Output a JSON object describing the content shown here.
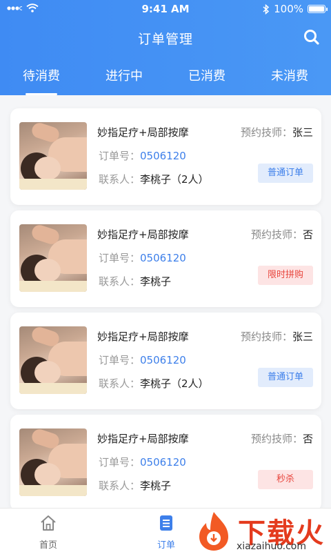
{
  "status_bar": {
    "time": "9:41 AM",
    "battery": "100%"
  },
  "header": {
    "title": "订单管理"
  },
  "tabs": [
    {
      "label": "待消费",
      "active": true
    },
    {
      "label": "进行中",
      "active": false
    },
    {
      "label": "已消费",
      "active": false
    },
    {
      "label": "未消费",
      "active": false
    }
  ],
  "orders": [
    {
      "name": "妙指足疗+局部按摩",
      "tech_label": "预约技师：",
      "tech_value": "张三",
      "order_label": "订单号：",
      "order_no": "0506120",
      "contact_label": "联系人：",
      "contact_value": "李桃子（2人）",
      "badge": "普通订单",
      "badge_color": "#3d7fea",
      "badge_bg": "#e2ecfc"
    },
    {
      "name": "妙指足疗+局部按摩",
      "tech_label": "预约技师：",
      "tech_value": "否",
      "order_label": "订单号：",
      "order_no": "0506120",
      "contact_label": "联系人：",
      "contact_value": "李桃子",
      "badge": "限时拼购",
      "badge_color": "#e8453c",
      "badge_bg": "#fde4e4"
    },
    {
      "name": "妙指足疗+局部按摩",
      "tech_label": "预约技师：",
      "tech_value": "张三",
      "order_label": "订单号：",
      "order_no": "0506120",
      "contact_label": "联系人：",
      "contact_value": "李桃子（2人）",
      "badge": "普通订单",
      "badge_color": "#3d7fea",
      "badge_bg": "#e2ecfc"
    },
    {
      "name": "妙指足疗+局部按摩",
      "tech_label": "预约技师：",
      "tech_value": "否",
      "order_label": "订单号：",
      "order_no": "0506120",
      "contact_label": "联系人：",
      "contact_value": "李桃子",
      "badge": "秒杀",
      "badge_color": "#e8453c",
      "badge_bg": "#fde4e4"
    }
  ],
  "bottom_nav": [
    {
      "label": "首页",
      "icon": "home-icon",
      "active": false,
      "color": "#666666"
    },
    {
      "label": "订单",
      "icon": "order-list-icon",
      "active": true,
      "color": "#3d7fea"
    }
  ],
  "watermark": {
    "text": "下载火",
    "url": "xiazaihuo.com"
  }
}
